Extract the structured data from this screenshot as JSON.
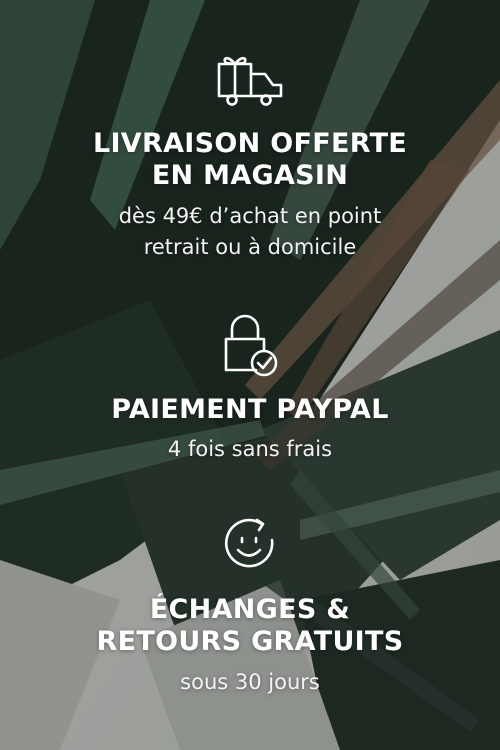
{
  "colors": {
    "text": "#ffffff",
    "background_dark": "#1e2a22",
    "background_light": "#c9cbc6"
  },
  "features": [
    {
      "icon": "gift-delivery-truck-icon",
      "title_lines": [
        "LIVRAISON OFFERTE",
        "EN MAGASIN"
      ],
      "subtitle_lines": [
        "dès 49€ d’achat en point",
        "retrait ou à domicile"
      ]
    },
    {
      "icon": "padlock-check-icon",
      "title_lines": [
        "PAIEMENT PAYPAL"
      ],
      "subtitle_lines": [
        "4 fois sans frais"
      ]
    },
    {
      "icon": "smile-refresh-icon",
      "title_lines": [
        "ÉCHANGES &",
        "RETOURS GRATUITS"
      ],
      "subtitle_lines": [
        "sous 30 jours"
      ]
    }
  ]
}
